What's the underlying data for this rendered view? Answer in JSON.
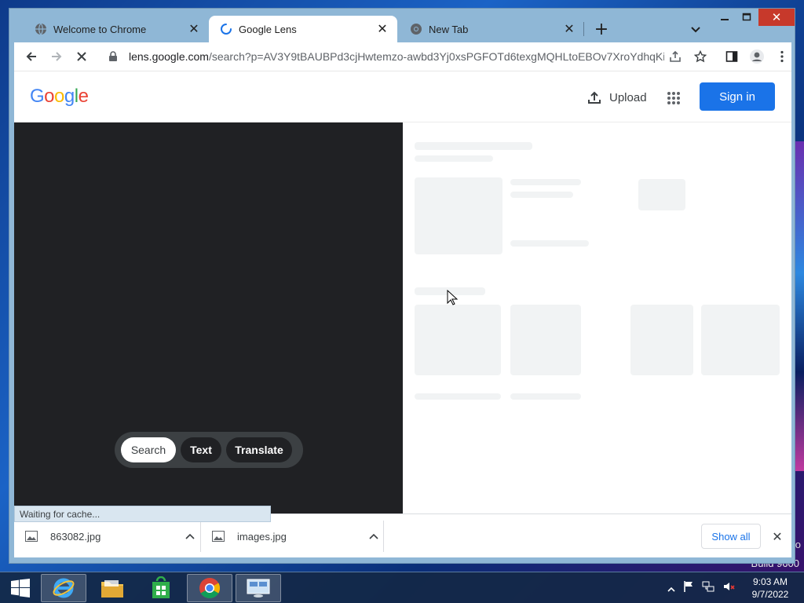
{
  "desktop": {
    "build_text": "Build 9600",
    "watermark_char": "o"
  },
  "browser": {
    "tabs": [
      {
        "label": "Welcome to Chrome",
        "icon": "globe-icon",
        "active": false
      },
      {
        "label": "Google Lens",
        "icon": "loading-spinner-icon",
        "active": true
      },
      {
        "label": "New Tab",
        "icon": "chrome-icon",
        "active": false
      }
    ],
    "url_host": "lens.google.com",
    "url_path": "/search?p=AV3Y9tBAUBPd3cjHwtemzo-awbd3Yj0xsPGFOTd6texgMQHLtoEBOv7XroYdhqKi..."
  },
  "page": {
    "logo_letters": [
      {
        "ch": "G",
        "color": "#4285F4"
      },
      {
        "ch": "o",
        "color": "#EA4335"
      },
      {
        "ch": "o",
        "color": "#FBBC05"
      },
      {
        "ch": "g",
        "color": "#4285F4"
      },
      {
        "ch": "l",
        "color": "#34A853"
      },
      {
        "ch": "e",
        "color": "#EA4335"
      }
    ],
    "upload_label": "Upload",
    "signin_label": "Sign in",
    "modes": {
      "search": "Search",
      "text": "Text",
      "translate": "Translate"
    },
    "status_text": "Waiting for cache..."
  },
  "downloads": {
    "items": [
      {
        "name": "863082.jpg"
      },
      {
        "name": "images.jpg"
      }
    ],
    "show_all_label": "Show all"
  },
  "taskbar": {
    "time": "9:03 AM",
    "date": "9/7/2022"
  },
  "colors": {
    "accent": "#1a73e8",
    "image_pane": "#202124",
    "close_red": "#c7392b"
  }
}
